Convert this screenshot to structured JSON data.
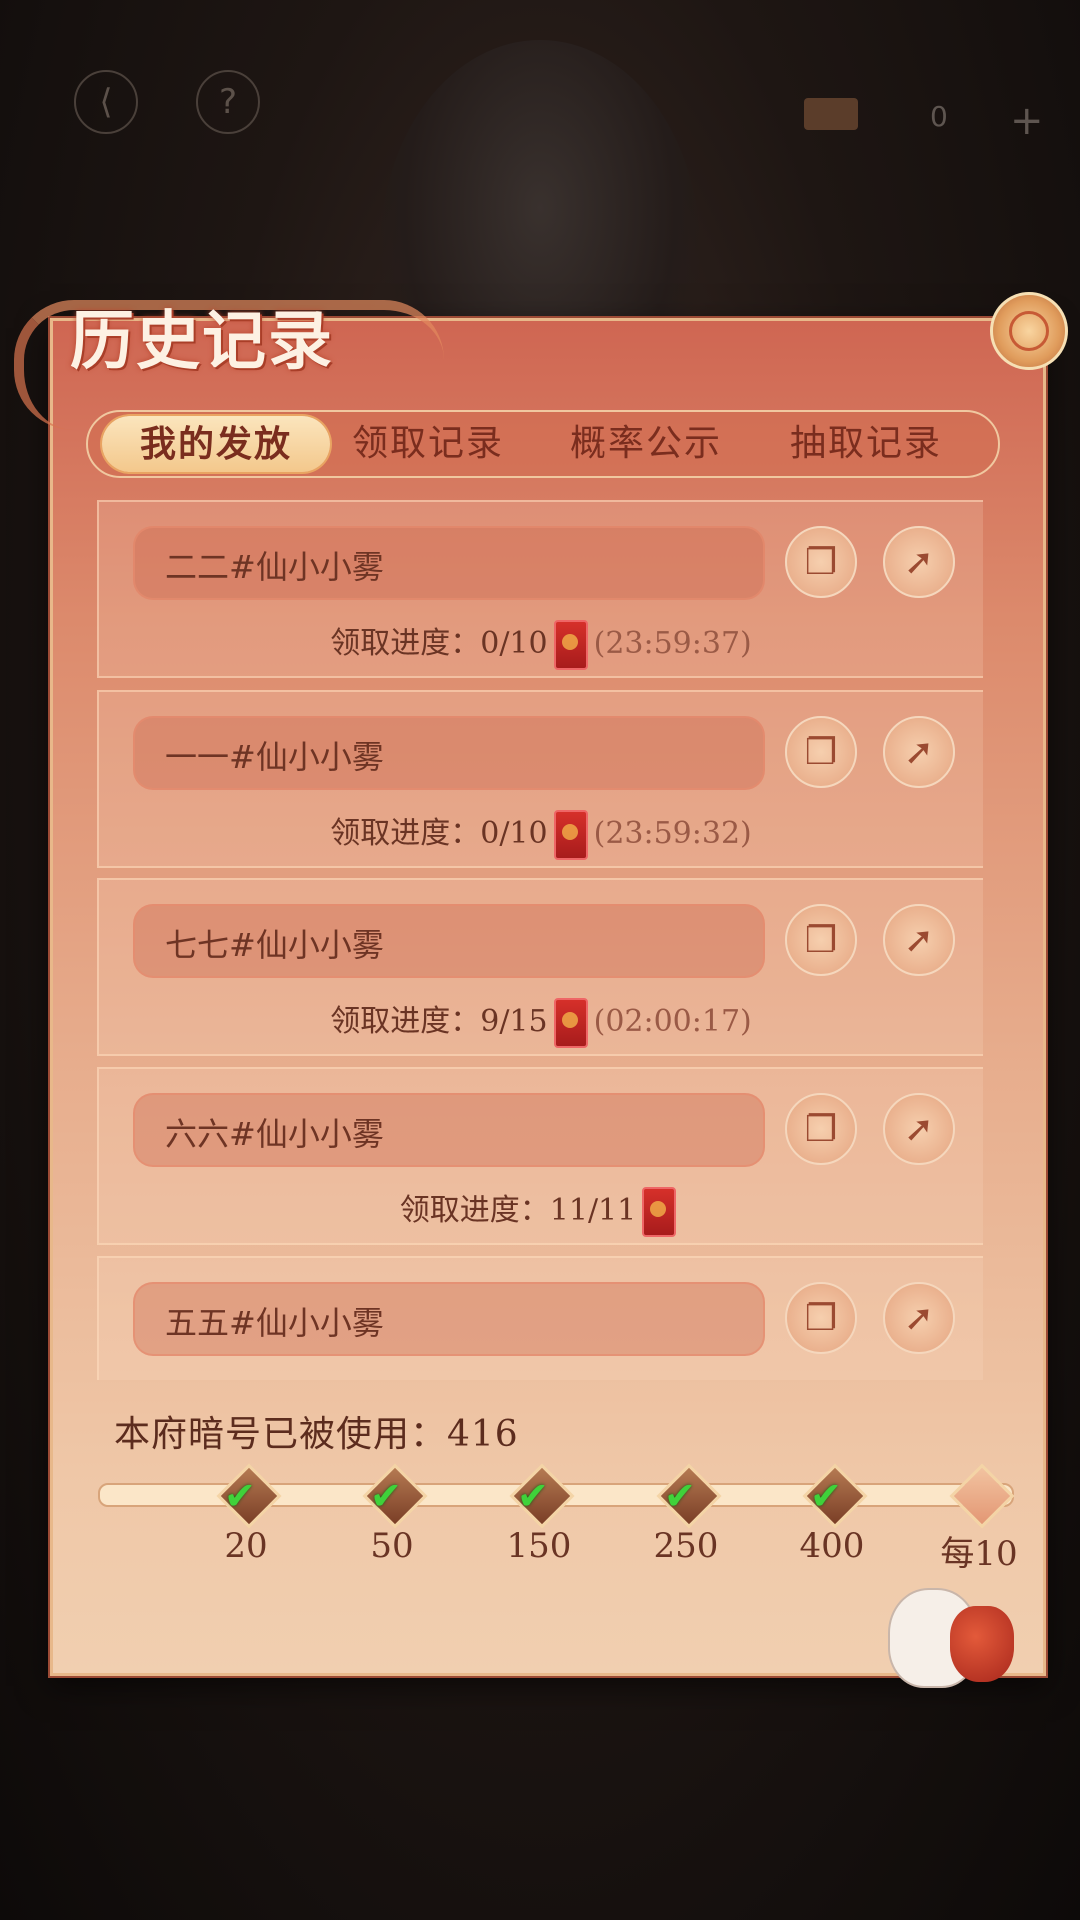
{
  "topbar": {
    "back_icon": "back-arrow-icon",
    "help_label": "?",
    "currency_value": "0",
    "add_label": "+"
  },
  "panel": {
    "title": "历史记录"
  },
  "tabs": [
    {
      "label": "我的发放",
      "active": true
    },
    {
      "label": "领取记录",
      "active": false
    },
    {
      "label": "概率公示",
      "active": false
    },
    {
      "label": "抽取记录",
      "active": false
    }
  ],
  "records": [
    {
      "name": "二二#仙小小雾",
      "progress_label": "领取进度：",
      "progress": "0/10",
      "timer": "(23:59:37)"
    },
    {
      "name": "一一#仙小小雾",
      "progress_label": "领取进度：",
      "progress": "0/10",
      "timer": "(23:59:32)"
    },
    {
      "name": "七七#仙小小雾",
      "progress_label": "领取进度：",
      "progress": "9/15",
      "timer": "(02:00:17)"
    },
    {
      "name": "六六#仙小小雾",
      "progress_label": "领取进度：",
      "progress": "11/11",
      "timer": ""
    },
    {
      "name": "五五#仙小小雾",
      "progress_label": "",
      "progress": "",
      "timer": ""
    }
  ],
  "usage": {
    "text": "本府暗号已被使用：416",
    "milestones": [
      {
        "label": "20",
        "done": true
      },
      {
        "label": "50",
        "done": true
      },
      {
        "label": "150",
        "done": true
      },
      {
        "label": "250",
        "done": true
      },
      {
        "label": "400",
        "done": true
      },
      {
        "label": "每10",
        "done": false
      }
    ]
  },
  "colors": {
    "accent": "#cf6652",
    "check_green": "#3fd23a",
    "text_brown": "#6a3424"
  },
  "icons": {
    "copy": "copy-icon",
    "share": "share-arrow-icon",
    "envelope": "red-envelope-icon"
  }
}
